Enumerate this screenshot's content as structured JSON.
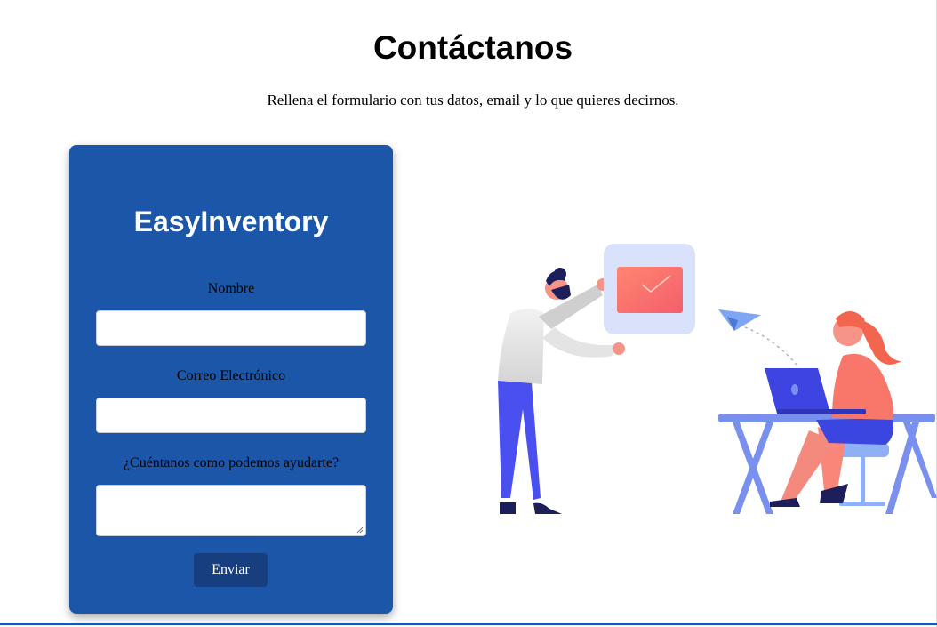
{
  "page": {
    "title": "Contáctanos",
    "subtitle": "Rellena el formulario con tus datos, email y lo que quieres decirnos."
  },
  "form": {
    "brand": "EasyInventory",
    "fields": [
      {
        "label": "Nombre",
        "value": "",
        "placeholder": ""
      },
      {
        "label": "Correo Electrónico",
        "value": "",
        "placeholder": ""
      },
      {
        "label": "¿Cuéntanos como podemos ayudarte?",
        "value": "",
        "placeholder": ""
      }
    ],
    "submit_label": "Enviar"
  },
  "illustration": {
    "icons": [
      "person-holding-envelope-icon",
      "envelope-card-icon",
      "paper-plane-icon",
      "woman-at-laptop-icon",
      "desk-icon",
      "chair-icon"
    ]
  },
  "colors": {
    "form_background": "#1b56a8",
    "button_background": "#173f7f",
    "accent_coral": "#f8726a",
    "accent_blue": "#4a5cf0"
  }
}
